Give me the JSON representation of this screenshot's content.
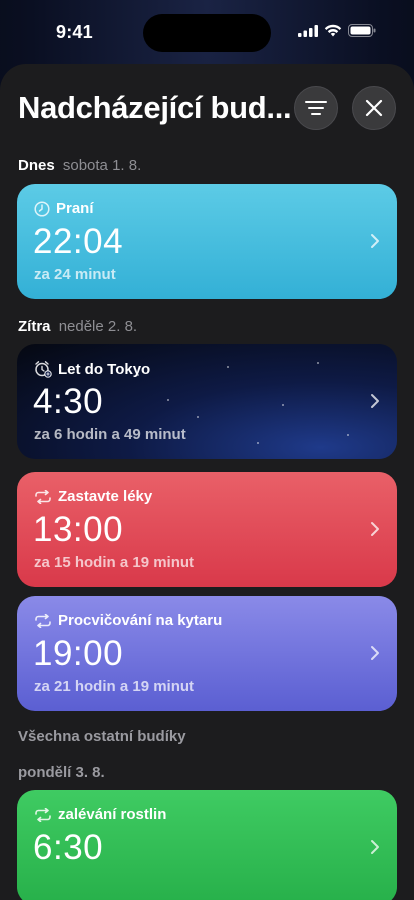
{
  "status_bar": {
    "time": "9:41"
  },
  "header": {
    "title": "Nadcházející bud..."
  },
  "sections": {
    "today": {
      "day": "Dnes",
      "date": "sobota 1. 8."
    },
    "tomorrow": {
      "day": "Zítra",
      "date": "neděle 2. 8."
    },
    "others": {
      "label": "Všechna ostatní budíky"
    },
    "monday": {
      "date": "pondělí 3. 8."
    }
  },
  "alarms": [
    {
      "label": "Praní",
      "time": "22:04",
      "countdown": "za 24 minut",
      "icon": "clock-icon",
      "color": "#3ab8dc"
    },
    {
      "label": "Let do Tokyo",
      "time": "4:30",
      "countdown": "za 6 hodin a 49 minut",
      "icon": "alarm-clock-icon",
      "color": "#0e1a45"
    },
    {
      "label": "Zastavte léky",
      "time": "13:00",
      "countdown": "za 15 hodin a 19 minut",
      "icon": "repeat-icon",
      "color": "#e04a56"
    },
    {
      "label": "Procvičování na kytaru",
      "time": "19:00",
      "countdown": "za 21 hodin a 19 minut",
      "icon": "repeat-icon",
      "color": "#6e72dc"
    },
    {
      "label": "zalévání rostlin",
      "time": "6:30",
      "icon": "repeat-icon",
      "color": "#33bd55"
    }
  ]
}
